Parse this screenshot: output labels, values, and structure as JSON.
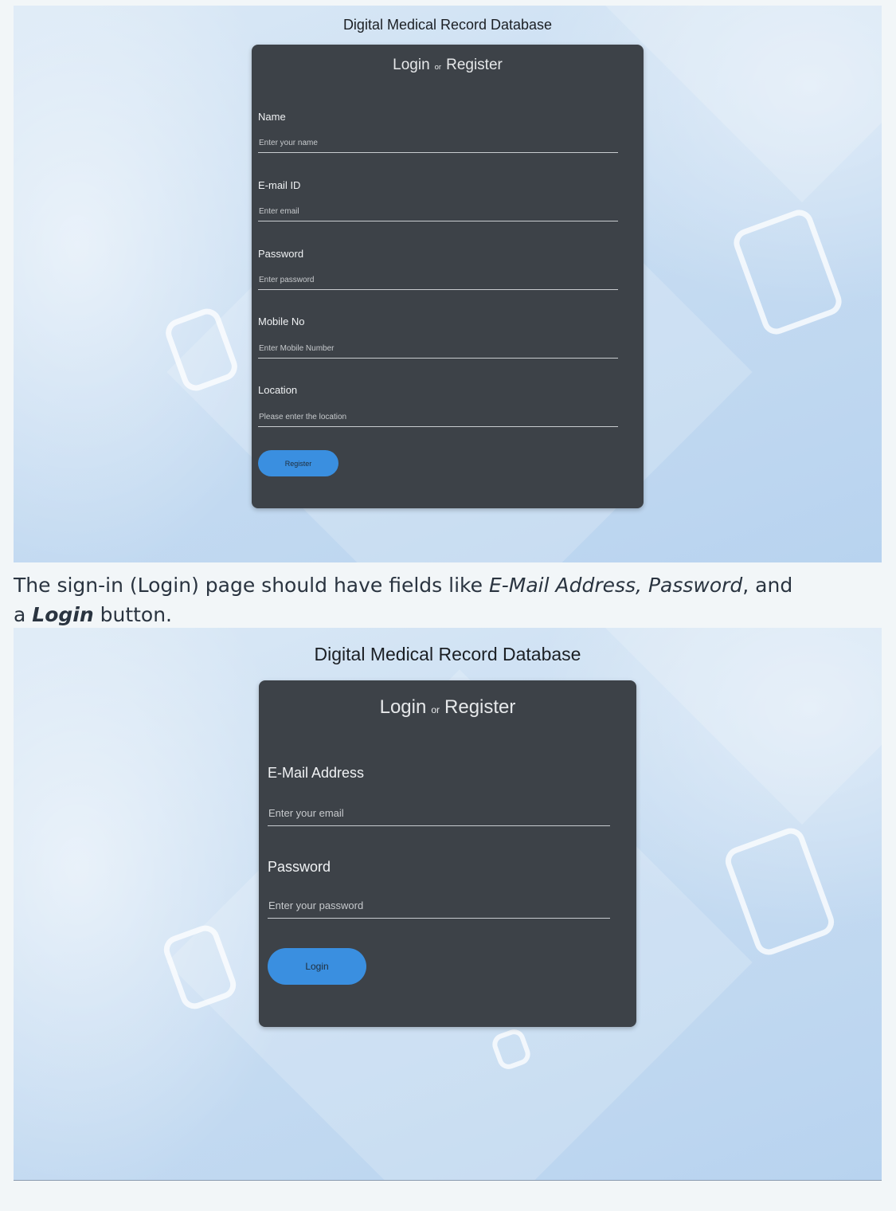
{
  "register_screenshot": {
    "site_title": "Digital Medical Record Database",
    "card_heading": {
      "login": "Login",
      "or": "or",
      "register": "Register"
    },
    "fields": [
      {
        "label": "Name",
        "placeholder": "Enter your name"
      },
      {
        "label": "E-mail ID",
        "placeholder": "Enter email"
      },
      {
        "label": "Password",
        "placeholder": "Enter password"
      },
      {
        "label": "Mobile No",
        "placeholder": "Enter Mobile Number"
      },
      {
        "label": "Location",
        "placeholder": "Please enter the location"
      }
    ],
    "submit_label": "Register"
  },
  "caption": {
    "prefix": "The sign-in (Login) page should have fields like ",
    "fields_text": "E-Mail Address, Password",
    "middle": ", and a ",
    "button_text": "Login",
    "suffix": " button."
  },
  "login_screenshot": {
    "site_title": "Digital Medical Record Database",
    "card_heading": {
      "login": "Login",
      "or": "or",
      "register": "Register"
    },
    "fields": [
      {
        "label": "E-Mail Address",
        "placeholder": "Enter your email"
      },
      {
        "label": "Password",
        "placeholder": "Enter your password"
      }
    ],
    "submit_label": "Login"
  },
  "colors": {
    "card_background": "#3d4248",
    "button_blue": "#3a8fe0",
    "page_background": "#f2f6f8"
  }
}
